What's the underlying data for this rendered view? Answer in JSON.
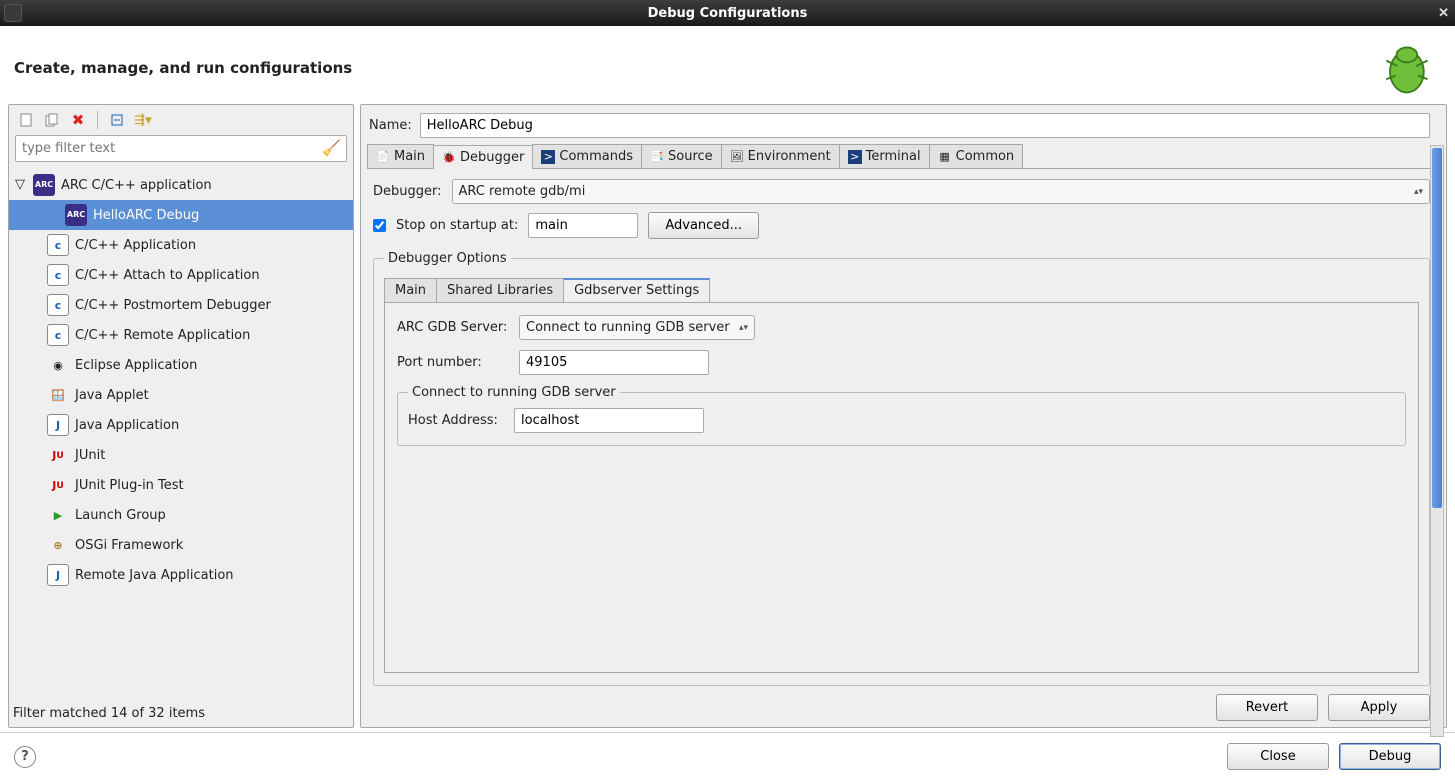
{
  "window": {
    "title": "Debug Configurations"
  },
  "header": {
    "title": "Create, manage, and run configurations"
  },
  "left": {
    "filter_placeholder": "type filter text",
    "root": {
      "label": "ARC C/C++ application"
    },
    "child": {
      "label": "HelloARC Debug"
    },
    "items": [
      {
        "label": "C/C++ Application",
        "icon": "C"
      },
      {
        "label": "C/C++ Attach to Application",
        "icon": "C"
      },
      {
        "label": "C/C++ Postmortem Debugger",
        "icon": "C"
      },
      {
        "label": "C/C++ Remote Application",
        "icon": "C"
      },
      {
        "label": "Eclipse Application",
        "icon": "◎"
      },
      {
        "label": "Java Applet",
        "icon": "☕"
      },
      {
        "label": "Java Application",
        "icon": "J"
      },
      {
        "label": "JUnit",
        "icon": "Ju"
      },
      {
        "label": "JUnit Plug-in Test",
        "icon": "Ju"
      },
      {
        "label": "Launch Group",
        "icon": "▶"
      },
      {
        "label": "OSGi Framework",
        "icon": "⊕"
      },
      {
        "label": "Remote Java Application",
        "icon": "J"
      }
    ],
    "filter_status": "Filter matched 14 of 32 items"
  },
  "right": {
    "name_label": "Name:",
    "name_value": "HelloARC Debug",
    "tabs": [
      {
        "label": "Main"
      },
      {
        "label": "Debugger"
      },
      {
        "label": "Commands"
      },
      {
        "label": "Source"
      },
      {
        "label": "Environment"
      },
      {
        "label": "Terminal"
      },
      {
        "label": "Common"
      }
    ],
    "debugger_label": "Debugger:",
    "debugger_value": "ARC remote gdb/mi",
    "stop_label": "Stop on startup at:",
    "stop_value": "main",
    "advanced_label": "Advanced...",
    "options_legend": "Debugger Options",
    "sub_tabs": [
      {
        "label": "Main"
      },
      {
        "label": "Shared Libraries"
      },
      {
        "label": "Gdbserver Settings"
      }
    ],
    "gdb_server_label": "ARC GDB Server:",
    "gdb_server_value": "Connect to running GDB server",
    "port_label": "Port number:",
    "port_value": "49105",
    "connect_legend": "Connect to running GDB server",
    "host_label": "Host Address:",
    "host_value": "localhost",
    "revert_label": "Revert",
    "apply_label": "Apply"
  },
  "footer": {
    "close_label": "Close",
    "debug_label": "Debug"
  }
}
